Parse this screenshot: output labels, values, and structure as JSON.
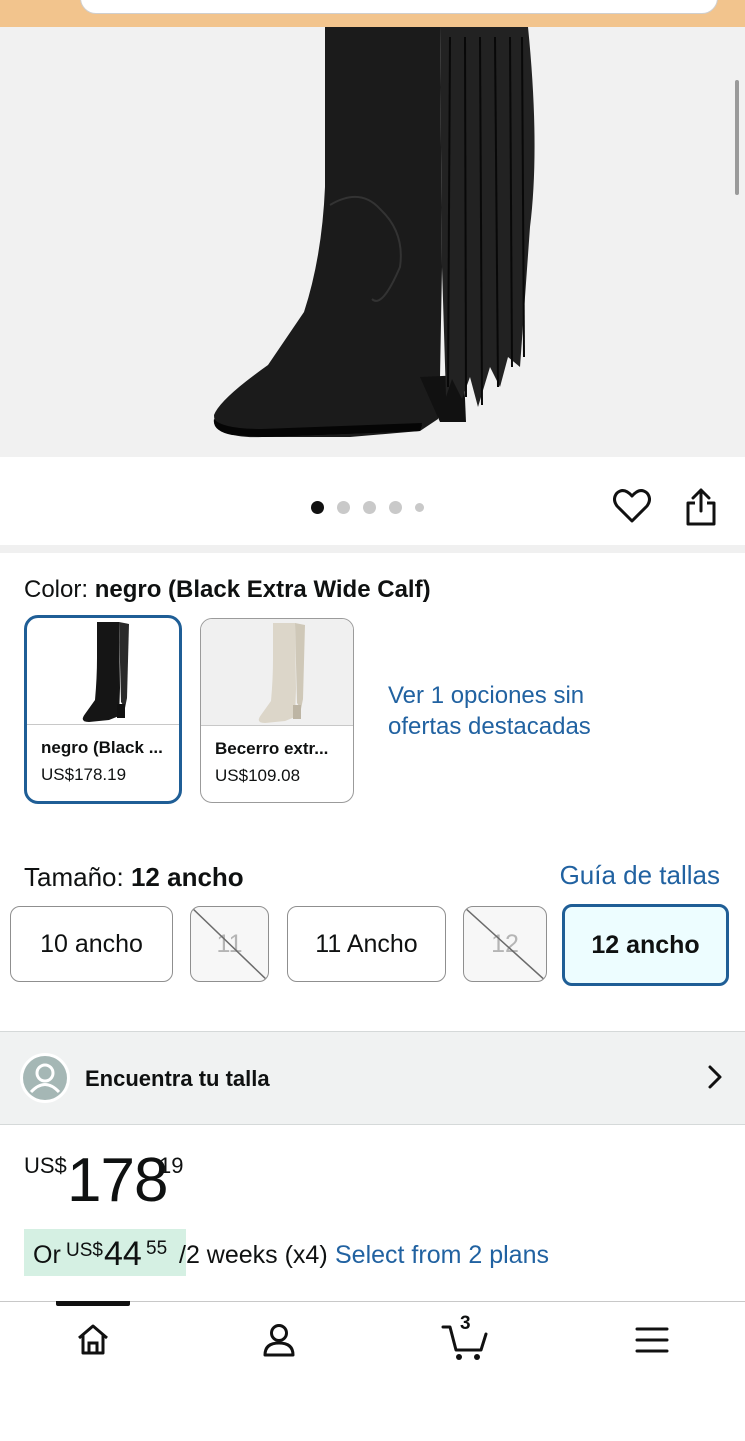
{
  "gallery": {
    "image_alt": "black fringe boot",
    "dots": 5,
    "active_dot": 0
  },
  "color": {
    "label": "Color:",
    "selected": "negro (Black Extra Wide Calf)",
    "swatches": [
      {
        "name": "negro (Black ...",
        "price": "US$178.19",
        "selected": true
      },
      {
        "name": "Becerro extr...",
        "price": "US$109.08",
        "selected": false
      }
    ],
    "more_options": "Ver 1 opciones sin ofertas destacadas"
  },
  "size": {
    "label": "Tamaño:",
    "selected": "12 ancho",
    "guide": "Guía de tallas",
    "options": [
      {
        "label": "10 ancho",
        "available": true,
        "selected": false
      },
      {
        "label": "11",
        "available": false,
        "selected": false
      },
      {
        "label": "11 Ancho",
        "available": true,
        "selected": false
      },
      {
        "label": "12",
        "available": false,
        "selected": false
      },
      {
        "label": "12 ancho",
        "available": true,
        "selected": true
      }
    ]
  },
  "find_size": {
    "label": "Encuentra tu talla"
  },
  "price": {
    "currency": "US$",
    "whole": "178",
    "fraction": "19"
  },
  "installment": {
    "or": "Or",
    "currency": "US$",
    "amount": "44",
    "cents": "55",
    "period": "/2 weeks (x4)",
    "plans_link": "Select from 2 plans"
  },
  "nav": {
    "items": [
      "home-icon",
      "account-icon",
      "cart-icon",
      "menu-icon"
    ],
    "cart_count": "3"
  },
  "colors": {
    "link": "#2162a1",
    "selected_border": "#1f5e96",
    "selected_bg": "#edfdff",
    "installment_bg": "#d5f0e3",
    "header_bg": "#f2c48d"
  }
}
